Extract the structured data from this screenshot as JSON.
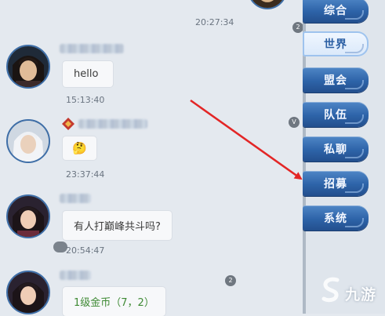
{
  "chat": {
    "messages": [
      {
        "time": "20:27:34"
      },
      {
        "text": "hello",
        "time": "15:13:40"
      },
      {
        "text": "🤔",
        "time": "23:37:44"
      },
      {
        "text": "有人打巅峰共斗吗?",
        "time": "20:54:47"
      },
      {
        "text": "1级金币（7，2）"
      }
    ]
  },
  "badges": {
    "top": "2",
    "middle": "V",
    "bottom": "2"
  },
  "tabs": [
    "综合",
    "世界",
    "盟会",
    "队伍",
    "私聊",
    "招募",
    "系统"
  ],
  "active_tab": "世界",
  "watermark": {
    "text": "九游"
  },
  "colors": {
    "tab": "#2d63a8",
    "active_tab": "#d9e8fa",
    "arrow": "#e32626",
    "gold_text": "#3f8a35"
  }
}
